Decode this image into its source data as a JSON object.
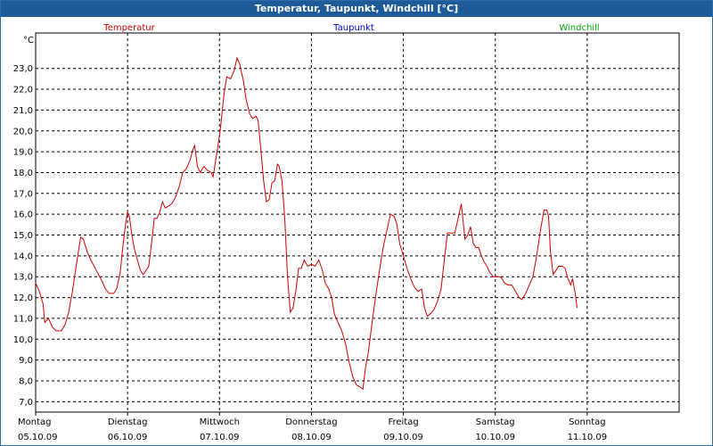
{
  "window": {
    "title": "Temperatur, Taupunkt, Windchill [°C]"
  },
  "chart_data": {
    "type": "line",
    "title": "Temperatur, Taupunkt, Windchill [°C]",
    "ylabel": "°C",
    "ylim": [
      6.5,
      24.7
    ],
    "yticks": [
      7.0,
      8.0,
      9.0,
      10.0,
      11.0,
      12.0,
      13.0,
      14.0,
      15.0,
      16.0,
      17.0,
      18.0,
      19.0,
      20.0,
      21.0,
      22.0,
      23.0
    ],
    "ytick_labels": [
      "7,0",
      "8,0",
      "9,0",
      "10,0",
      "11,0",
      "12,0",
      "13,0",
      "14,0",
      "15,0",
      "16,0",
      "17,0",
      "18,0",
      "19,0",
      "20,0",
      "21,0",
      "22,0",
      "23,0"
    ],
    "grid": true,
    "legend_position": "top",
    "xlim": [
      0,
      7.0
    ],
    "x_ticks": [
      {
        "day": "Montag",
        "date": "05.10.09"
      },
      {
        "day": "Dienstag",
        "date": "06.10.09"
      },
      {
        "day": "Mittwoch",
        "date": "07.10.09"
      },
      {
        "day": "Donnerstag",
        "date": "08.10.09"
      },
      {
        "day": "Freitag",
        "date": "09.10.09"
      },
      {
        "day": "Samstag",
        "date": "10.10.09"
      },
      {
        "day": "Sonntag",
        "date": "11.10.09"
      }
    ],
    "series": [
      {
        "name": "Temperatur",
        "color": "#cc0000",
        "points": [
          [
            0.0,
            12.7
          ],
          [
            0.04,
            12.3
          ],
          [
            0.08,
            11.7
          ],
          [
            0.1,
            10.8
          ],
          [
            0.14,
            11.0
          ],
          [
            0.18,
            10.6
          ],
          [
            0.22,
            10.4
          ],
          [
            0.28,
            10.4
          ],
          [
            0.32,
            10.7
          ],
          [
            0.36,
            11.3
          ],
          [
            0.4,
            12.3
          ],
          [
            0.44,
            13.5
          ],
          [
            0.49,
            14.9
          ],
          [
            0.52,
            14.8
          ],
          [
            0.56,
            14.2
          ],
          [
            0.6,
            13.8
          ],
          [
            0.66,
            13.3
          ],
          [
            0.72,
            12.8
          ],
          [
            0.76,
            12.4
          ],
          [
            0.8,
            12.2
          ],
          [
            0.85,
            12.2
          ],
          [
            0.88,
            12.4
          ],
          [
            0.92,
            13.2
          ],
          [
            0.95,
            14.5
          ],
          [
            0.98,
            15.6
          ],
          [
            1.0,
            16.1
          ],
          [
            1.02,
            15.9
          ],
          [
            1.04,
            15.2
          ],
          [
            1.07,
            14.4
          ],
          [
            1.1,
            13.9
          ],
          [
            1.14,
            13.3
          ],
          [
            1.17,
            13.1
          ],
          [
            1.2,
            13.3
          ],
          [
            1.23,
            13.5
          ],
          [
            1.26,
            14.6
          ],
          [
            1.29,
            15.8
          ],
          [
            1.32,
            15.8
          ],
          [
            1.35,
            16.1
          ],
          [
            1.38,
            16.6
          ],
          [
            1.41,
            16.3
          ],
          [
            1.45,
            16.4
          ],
          [
            1.48,
            16.5
          ],
          [
            1.52,
            16.8
          ],
          [
            1.56,
            17.3
          ],
          [
            1.6,
            18.0
          ],
          [
            1.64,
            18.2
          ],
          [
            1.68,
            18.6
          ],
          [
            1.71,
            19.1
          ],
          [
            1.73,
            19.3
          ],
          [
            1.76,
            18.3
          ],
          [
            1.79,
            18.0
          ],
          [
            1.83,
            18.3
          ],
          [
            1.87,
            18.1
          ],
          [
            1.91,
            18.0
          ],
          [
            1.93,
            17.8
          ],
          [
            1.97,
            18.9
          ],
          [
            2.01,
            20.1
          ],
          [
            2.05,
            21.8
          ],
          [
            2.08,
            22.6
          ],
          [
            2.12,
            22.5
          ],
          [
            2.16,
            22.9
          ],
          [
            2.19,
            23.5
          ],
          [
            2.22,
            23.2
          ],
          [
            2.26,
            22.4
          ],
          [
            2.29,
            21.5
          ],
          [
            2.33,
            20.8
          ],
          [
            2.36,
            20.6
          ],
          [
            2.4,
            20.7
          ],
          [
            2.42,
            20.5
          ],
          [
            2.45,
            19.1
          ],
          [
            2.48,
            17.6
          ],
          [
            2.51,
            16.6
          ],
          [
            2.54,
            16.7
          ],
          [
            2.57,
            17.5
          ],
          [
            2.6,
            17.6
          ],
          [
            2.63,
            18.4
          ],
          [
            2.65,
            18.3
          ],
          [
            2.68,
            17.6
          ],
          [
            2.71,
            15.8
          ],
          [
            2.74,
            13.0
          ],
          [
            2.77,
            11.3
          ],
          [
            2.8,
            11.5
          ],
          [
            2.83,
            12.3
          ],
          [
            2.86,
            13.4
          ],
          [
            2.89,
            13.4
          ],
          [
            2.92,
            13.8
          ],
          [
            2.96,
            13.5
          ],
          [
            3.0,
            13.6
          ],
          [
            3.04,
            13.5
          ],
          [
            3.08,
            13.8
          ],
          [
            3.12,
            13.3
          ],
          [
            3.15,
            12.7
          ],
          [
            3.19,
            12.4
          ],
          [
            3.22,
            12.0
          ],
          [
            3.25,
            11.2
          ],
          [
            3.29,
            10.8
          ],
          [
            3.33,
            10.4
          ],
          [
            3.37,
            9.8
          ],
          [
            3.41,
            8.9
          ],
          [
            3.45,
            8.2
          ],
          [
            3.49,
            7.8
          ],
          [
            3.53,
            7.7
          ],
          [
            3.56,
            7.6
          ],
          [
            3.59,
            8.7
          ],
          [
            3.62,
            9.4
          ],
          [
            3.66,
            10.8
          ],
          [
            3.7,
            12.1
          ],
          [
            3.74,
            13.3
          ],
          [
            3.78,
            14.4
          ],
          [
            3.82,
            15.2
          ],
          [
            3.86,
            16.0
          ],
          [
            3.9,
            15.9
          ],
          [
            3.93,
            15.5
          ],
          [
            3.96,
            14.6
          ],
          [
            4.0,
            14.0
          ],
          [
            4.04,
            13.4
          ],
          [
            4.08,
            12.9
          ],
          [
            4.12,
            12.5
          ],
          [
            4.16,
            12.3
          ],
          [
            4.2,
            12.4
          ],
          [
            4.23,
            11.5
          ],
          [
            4.26,
            11.1
          ],
          [
            4.29,
            11.2
          ],
          [
            4.33,
            11.4
          ],
          [
            4.37,
            11.8
          ],
          [
            4.41,
            12.4
          ],
          [
            4.45,
            14.0
          ],
          [
            4.48,
            15.1
          ],
          [
            4.52,
            15.1
          ],
          [
            4.56,
            15.1
          ],
          [
            4.6,
            15.9
          ],
          [
            4.63,
            16.5
          ],
          [
            4.67,
            14.8
          ],
          [
            4.7,
            15.0
          ],
          [
            4.73,
            15.4
          ],
          [
            4.76,
            14.6
          ],
          [
            4.79,
            14.4
          ],
          [
            4.82,
            14.4
          ],
          [
            4.85,
            14.0
          ],
          [
            4.88,
            13.7
          ],
          [
            4.91,
            13.5
          ],
          [
            4.94,
            13.2
          ],
          [
            4.98,
            13.0
          ],
          [
            5.02,
            13.0
          ],
          [
            5.06,
            13.0
          ],
          [
            5.1,
            12.7
          ],
          [
            5.14,
            12.6
          ],
          [
            5.18,
            12.6
          ],
          [
            5.22,
            12.3
          ],
          [
            5.26,
            12.0
          ],
          [
            5.29,
            11.9
          ],
          [
            5.33,
            12.2
          ],
          [
            5.37,
            12.6
          ],
          [
            5.41,
            13.0
          ],
          [
            5.45,
            14.0
          ],
          [
            5.49,
            15.2
          ],
          [
            5.53,
            16.2
          ],
          [
            5.56,
            16.2
          ],
          [
            5.58,
            15.9
          ],
          [
            5.6,
            14.2
          ],
          [
            5.63,
            13.1
          ],
          [
            5.66,
            13.3
          ],
          [
            5.69,
            13.5
          ],
          [
            5.73,
            13.5
          ],
          [
            5.76,
            13.4
          ],
          [
            5.79,
            12.9
          ],
          [
            5.82,
            12.6
          ],
          [
            5.84,
            12.9
          ],
          [
            5.87,
            12.2
          ],
          [
            5.89,
            11.5
          ]
        ]
      },
      {
        "name": "Taupunkt",
        "color": "#0000cc",
        "points": []
      },
      {
        "name": "Windchill",
        "color": "#00aa00",
        "points": []
      }
    ]
  }
}
